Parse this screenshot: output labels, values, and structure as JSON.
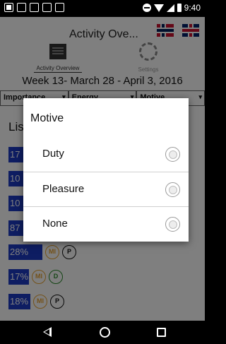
{
  "status_bar": {
    "time": "9:40",
    "left_icons": [
      "notification-icon",
      "image-icon",
      "image-icon",
      "sim-icon",
      "camera-icon"
    ],
    "right_icons": [
      "do-not-disturb-icon",
      "wifi-icon",
      "signal-icon",
      "battery-icon"
    ]
  },
  "app": {
    "title": "Activity Ove...",
    "flags": [
      "norway-flag-icon",
      "uk-flag-icon"
    ],
    "tabs": [
      {
        "label": "Activity Overview",
        "icon": "list-icon"
      },
      {
        "label": "Settings",
        "icon": "gear-icon"
      }
    ],
    "week_label": "Week 13- March 28 - April 3, 2016",
    "filters": [
      "Importance",
      "Energy",
      "Motive"
    ],
    "list_title": "Lis",
    "rows": [
      {
        "percent": "17",
        "fill": 0.1,
        "badges": []
      },
      {
        "percent": "10",
        "fill": 0.1,
        "badges": []
      },
      {
        "percent": "10",
        "fill": 0.1,
        "badges": []
      },
      {
        "percent": "87",
        "fill": 0.1,
        "badges": []
      },
      {
        "percent": "28%",
        "fill": 0.28,
        "badges": [
          {
            "text": "MI",
            "type": "mi"
          },
          {
            "text": "P",
            "type": "p"
          }
        ]
      },
      {
        "percent": "17%",
        "fill": 0.17,
        "badges": [
          {
            "text": "MI",
            "type": "mi"
          },
          {
            "text": "D",
            "type": "d"
          }
        ]
      },
      {
        "percent": "18%",
        "fill": 0.18,
        "badges": [
          {
            "text": "MI",
            "type": "mi"
          },
          {
            "text": "P",
            "type": "p"
          }
        ]
      }
    ]
  },
  "dialog": {
    "title": "Motive",
    "options": [
      {
        "label": "Duty",
        "selected": false
      },
      {
        "label": "Pleasure",
        "selected": false
      },
      {
        "label": "None",
        "selected": false
      }
    ]
  },
  "nav_bar": {
    "buttons": [
      "back-icon",
      "home-icon",
      "recent-apps-icon"
    ]
  },
  "colors": {
    "bar": "#1d3bc4",
    "badge_mi": "#e8a435",
    "badge_d": "#2a8a2a",
    "badge_p": "#111111"
  }
}
